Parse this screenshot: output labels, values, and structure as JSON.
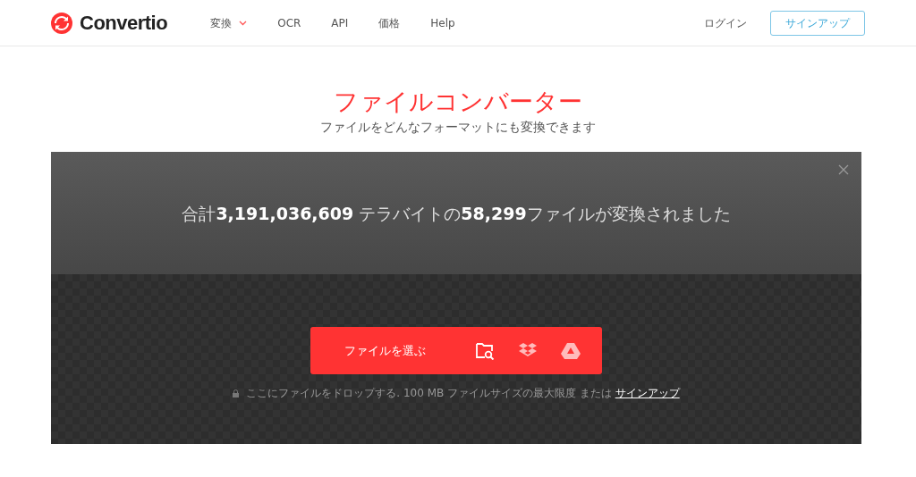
{
  "header": {
    "logo": "Convertio",
    "nav": [
      {
        "label": "変換",
        "has_menu": true
      },
      {
        "label": "OCR",
        "has_menu": false
      },
      {
        "label": "API",
        "has_menu": false
      },
      {
        "label": "価格",
        "has_menu": false
      },
      {
        "label": "Help",
        "has_menu": false
      }
    ],
    "login": "ログイン",
    "signup": "サインアップ"
  },
  "hero": {
    "title": "ファイルコンバーター",
    "subtitle": "ファイルをどんなフォーマットにも変換できます"
  },
  "panel": {
    "stats": "合計**3,191,036,609** テラバイトの**58,299**ファイルが変換されました",
    "choose_button": "ファイルを選ぶ",
    "drop_hint": "ここにファイルをドロップする. 100 MB ファイルサイズの最大限度 または ",
    "signup_link": "サインアップ"
  }
}
